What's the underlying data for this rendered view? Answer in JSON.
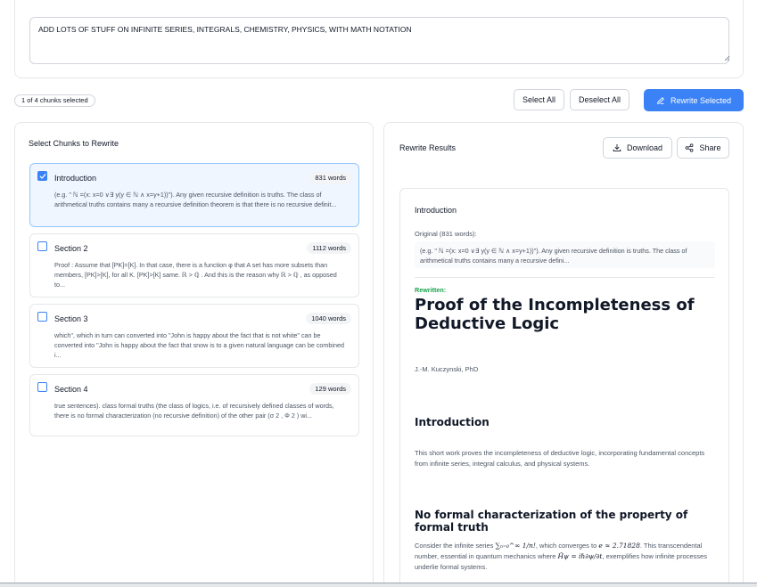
{
  "prompt": {
    "value": "ADD LOTS OF STUFF ON INFINITE SERIES, INTEGRALS, CHEMISTRY, PHYSICS, WITH MATH NOTATION"
  },
  "selection": {
    "badge": "1 of 4 chunks selected",
    "select_all_label": "Select All",
    "deselect_all_label": "Deselect All",
    "rewrite_label": "Rewrite Selected"
  },
  "chunks_panel": {
    "title": "Select Chunks to Rewrite",
    "chunks": [
      {
        "title": "Introduction",
        "words": "831 words",
        "checked": true,
        "excerpt": "(e.g. \" ℕ =(x: x=0 ∨∃ y(y ∈ ℕ ∧ x=y+1))\"). Any given recursive definition is truths. The class of arithmetical truths contains many a recursive definition theorem is that there is no recursive definit..."
      },
      {
        "title": "Section 2",
        "words": "1112 words",
        "checked": false,
        "excerpt": "Proof : Assume that [PK]=[K]. In that case, there is a function φ that A set has more subsets than members, [PK]>[K], for all K. [PK]>[K] same. ℝ > ℚ . And this is the reason why ℝ > ℚ , as opposed to..."
      },
      {
        "title": "Section 3",
        "words": "1040 words",
        "checked": false,
        "excerpt": "which\", which in turn can converted into \"John is happy about the fact that is not white\" can be converted into \"John is happy about the fact that snow is to a given natural language can be combined i..."
      },
      {
        "title": "Section 4",
        "words": "129 words",
        "checked": false,
        "excerpt": "true sentences). class formal truths (the class of logics, i.e. of recursively defined classes of words, there is no formal characterization (no recursive definition) of the other pair (σ 2 , Φ 2 ) wi..."
      }
    ]
  },
  "results_panel": {
    "title": "Rewrite Results",
    "download_label": "Download",
    "share_label": "Share",
    "result": {
      "chunk_title": "Introduction",
      "original_label": "Original (831 words):",
      "original_excerpt": "(e.g. \" ℕ =(x: x=0 ∨∃ y(y ∈ ℕ ∧ x=y+1))\"). Any given recursive definition is truths. The class of arithmetical truths contains many a recursive defini...",
      "rewritten_label": "Rewritten:",
      "doc_title": "Proof of the Incompleteness of Deductive Logic",
      "author": "J.-M. Kuczynski, PhD",
      "section1_heading": "Introduction",
      "section1_text": "This short work proves the incompleteness of deductive logic, incorporating fundamental concepts from infinite series, integral calculus, and physical systems.",
      "section2_heading": "No formal characterization of the property of formal truth",
      "section2_text_a": "Consider the infinite series ",
      "section2_math_a": "∑ₙ₌₀^∞ 1/n!",
      "section2_text_b": ", which converges to ",
      "section2_math_b": "e ≈ 2.71828",
      "section2_text_c": ". This transcendental number, essential in quantum mechanics where ",
      "section2_math_c": "Ĥψ = iℏ∂ψ/∂t",
      "section2_text_d": ", exemplifies how infinite processes underlie formal systems."
    }
  },
  "colors": {
    "accent": "#3b82f6",
    "rewritten_label": "#16a34a",
    "selected_chunk_bg": "#eff6ff"
  },
  "icons": {
    "checkbox_checked": "check-icon",
    "rewrite": "pencil-icon",
    "download": "download-icon",
    "share": "share-icon"
  }
}
